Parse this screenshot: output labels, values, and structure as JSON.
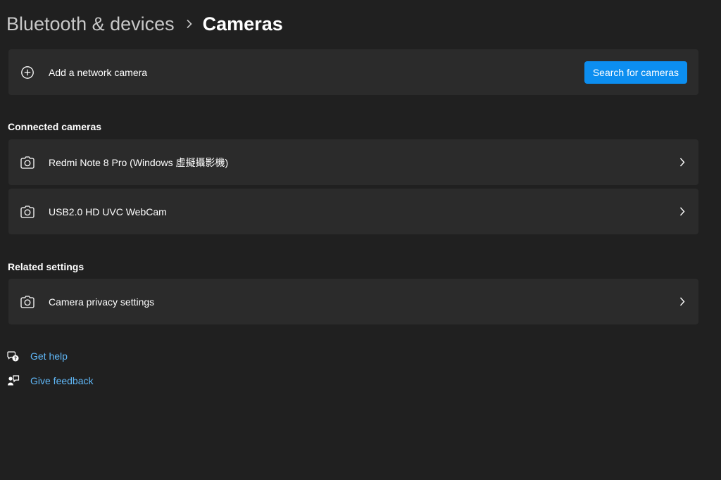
{
  "breadcrumb": {
    "parent": "Bluetooth & devices",
    "current": "Cameras"
  },
  "add_camera": {
    "label": "Add a network camera",
    "button": "Search for cameras",
    "icon": "add-circle-icon"
  },
  "connected": {
    "title": "Connected cameras",
    "items": [
      {
        "label": "Redmi Note 8 Pro (Windows 虛擬攝影機)",
        "icon": "camera-icon"
      },
      {
        "label": "USB2.0 HD UVC WebCam",
        "icon": "camera-icon"
      }
    ]
  },
  "related": {
    "title": "Related settings",
    "items": [
      {
        "label": "Camera privacy settings",
        "icon": "camera-icon"
      }
    ]
  },
  "help_links": {
    "get_help": "Get help",
    "give_feedback": "Give feedback"
  },
  "colors": {
    "background": "#202020",
    "card": "#2b2b2b",
    "accent": "#0c8ef0",
    "link": "#60b8f8"
  }
}
